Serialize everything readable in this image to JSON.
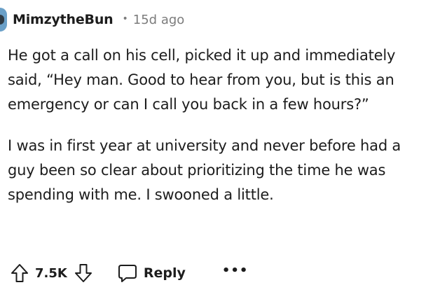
{
  "comment": {
    "author": "MimzytheBun",
    "separator": "•",
    "time_ago": "15d ago",
    "paragraphs": [
      "He got a call on his cell, picked it up and immediately said, “Hey man. Good to hear from you, but is this an emergency or can I call you back in a few hours?”",
      "I was in first year at university and never before had a guy been so clear about prioritizing the time he was spending with me. I swooned a little."
    ]
  },
  "actions": {
    "upvote_icon": "arrow-up-outline-icon",
    "vote_count": "7.5K",
    "downvote_icon": "arrow-down-outline-icon",
    "reply_icon": "speech-bubble-icon",
    "reply_label": "Reply",
    "more_label": "•••"
  },
  "colors": {
    "text": "#1c1c1c",
    "muted": "#7c7c7c",
    "avatar": "#6aa0c8"
  }
}
